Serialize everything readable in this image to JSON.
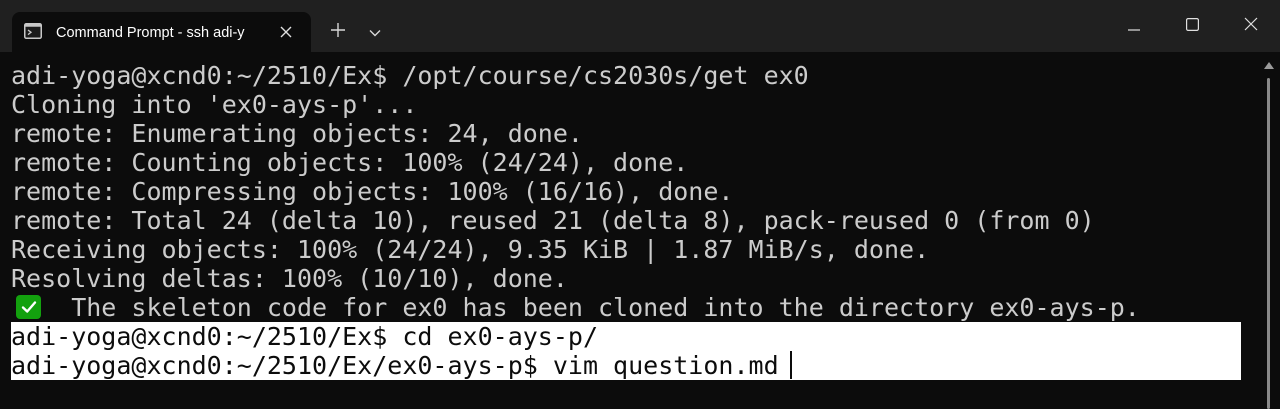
{
  "tab": {
    "title": "Command Prompt - ssh  adi-y",
    "icon": "terminal-icon"
  },
  "tabbar": {
    "new_tab_icon": "plus-icon",
    "dropdown_icon": "chevron-down-icon"
  },
  "window_controls": [
    "minimize-icon",
    "maximize-icon",
    "close-icon"
  ],
  "terminal": {
    "lines": [
      "adi-yoga@xcnd0:~/2510/Ex$ /opt/course/cs2030s/get ex0",
      "Cloning into 'ex0-ays-p'...",
      "remote: Enumerating objects: 24, done.",
      "remote: Counting objects: 100% (24/24), done.",
      "remote: Compressing objects: 100% (16/16), done.",
      "remote: Total 24 (delta 10), reused 21 (delta 8), pack-reused 0 (from 0)",
      "Receiving objects: 100% (24/24), 9.35 KiB | 1.87 MiB/s, done.",
      "Resolving deltas: 100% (10/10), done.",
      "    The skeleton code for ex0 has been cloned into the directory ex0-ays-p.",
      "adi-yoga@xcnd0:~/2510/Ex$ cd ex0-ays-p/",
      "adi-yoga@xcnd0:~/2510/Ex/ex0-ays-p$ vim question.md"
    ],
    "status_icon": "check-mark-icon",
    "colors": {
      "background": "#0c0c0c",
      "foreground": "#cccccc",
      "selection": "#ffffff",
      "check": "#13a10e"
    }
  }
}
